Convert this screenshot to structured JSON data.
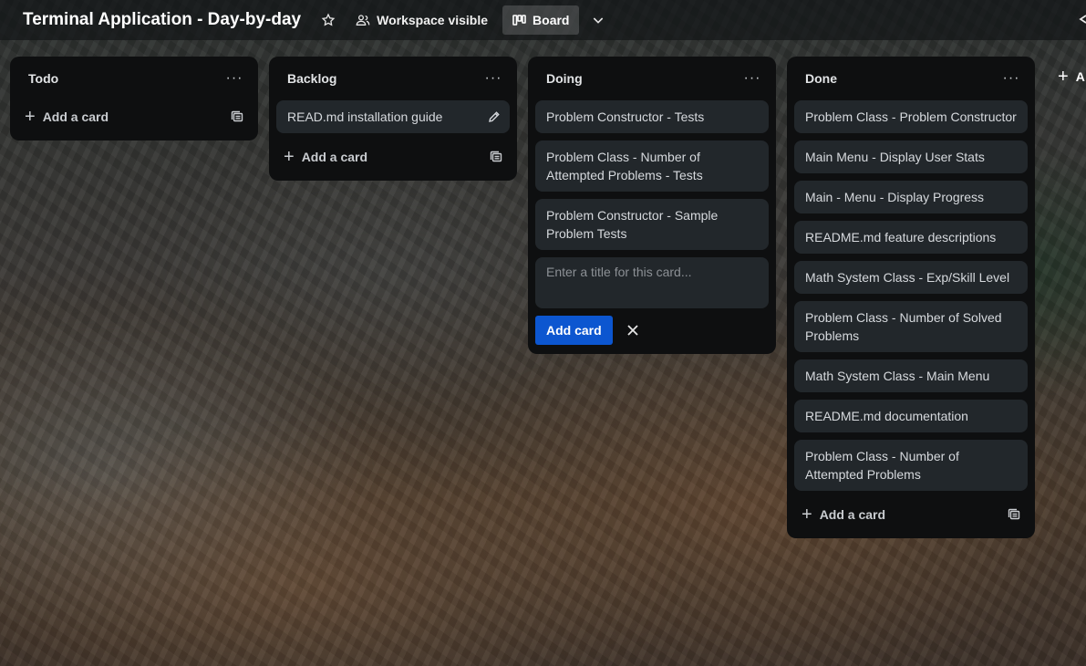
{
  "header": {
    "board_title": "Terminal Application - Day-by-day",
    "visibility_label": "Workspace visible",
    "view_label": "Board"
  },
  "lists": [
    {
      "title": "Todo",
      "cards": [],
      "add_label": "Add a card"
    },
    {
      "title": "Backlog",
      "cards": [
        "READ.md installation guide"
      ],
      "add_label": "Add a card"
    },
    {
      "title": "Doing",
      "cards": [
        "Problem Constructor - Tests",
        "Problem Class - Number of Attempted Problems - Tests",
        "Problem Constructor - Sample Problem Tests"
      ],
      "composer_placeholder": "Enter a title for this card...",
      "composer_submit": "Add card"
    },
    {
      "title": "Done",
      "cards": [
        "Problem Class - Problem Constructor",
        "Main Menu - Display User Stats",
        "Main - Menu - Display Progress",
        "README.md feature descriptions",
        "Math System Class - Exp/Skill Level",
        "Problem Class - Number of Solved Problems",
        "Math System Class - Main Menu",
        "README.md documentation",
        "Problem Class - Number of Attempted Problems"
      ],
      "add_label": "Add a card"
    }
  ],
  "add_list_label": "A",
  "icons": {
    "list_menu": "ellipsis-icon",
    "star": "star-icon",
    "visibility": "people-icon",
    "board": "board-icon",
    "template": "card-template-icon",
    "edit": "pencil-icon",
    "close": "close-icon"
  },
  "colors": {
    "list_bg": "#0e0f10",
    "card_bg": "#22272b",
    "primary_button": "#0c56d0",
    "text": "#d6d9dd"
  }
}
